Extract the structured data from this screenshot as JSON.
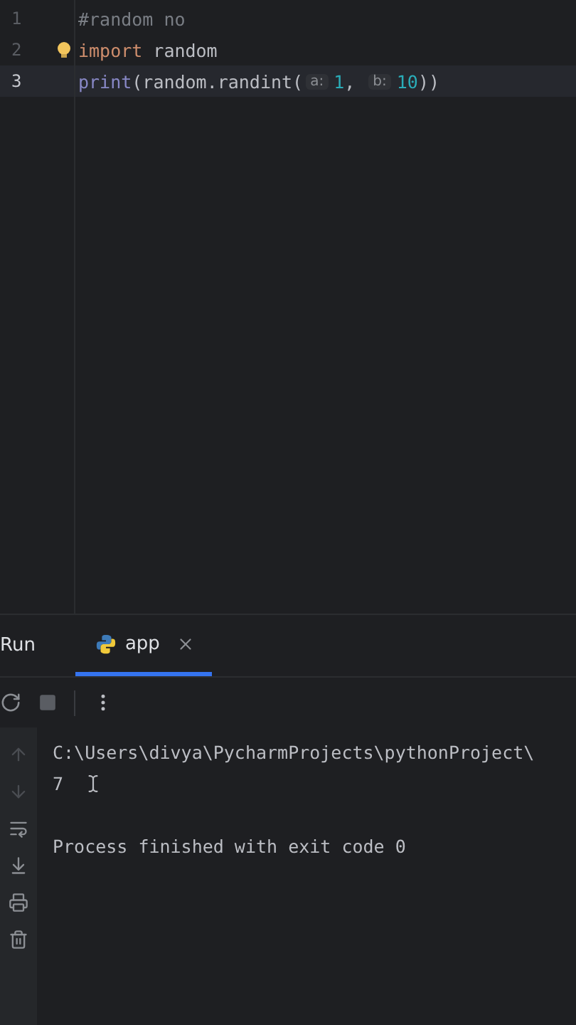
{
  "editor": {
    "lines": [
      {
        "number": "1",
        "current": false,
        "bulb": false,
        "tokens": [
          {
            "kind": "comment",
            "text": "#random no"
          }
        ]
      },
      {
        "number": "2",
        "current": false,
        "bulb": true,
        "tokens": [
          {
            "kind": "keyword",
            "text": "import"
          },
          {
            "kind": "plain",
            "text": " random"
          }
        ]
      },
      {
        "number": "3",
        "current": true,
        "bulb": false,
        "tokens": [
          {
            "kind": "builtin",
            "text": "print"
          },
          {
            "kind": "plain",
            "text": "(random.randint("
          },
          {
            "kind": "hint",
            "text": "a:"
          },
          {
            "kind": "number",
            "text": "1"
          },
          {
            "kind": "plain",
            "text": ", "
          },
          {
            "kind": "hint",
            "text": "b:"
          },
          {
            "kind": "number",
            "text": "10"
          },
          {
            "kind": "plain",
            "text": "))"
          }
        ]
      }
    ]
  },
  "run_panel": {
    "title": "Run",
    "tabs": [
      {
        "label": "app",
        "selected": true
      }
    ],
    "console": {
      "lines": [
        "C:\\Users\\divya\\PycharmProjects\\pythonProject\\",
        "7"
      ],
      "status": "Process finished with exit code 0"
    }
  }
}
